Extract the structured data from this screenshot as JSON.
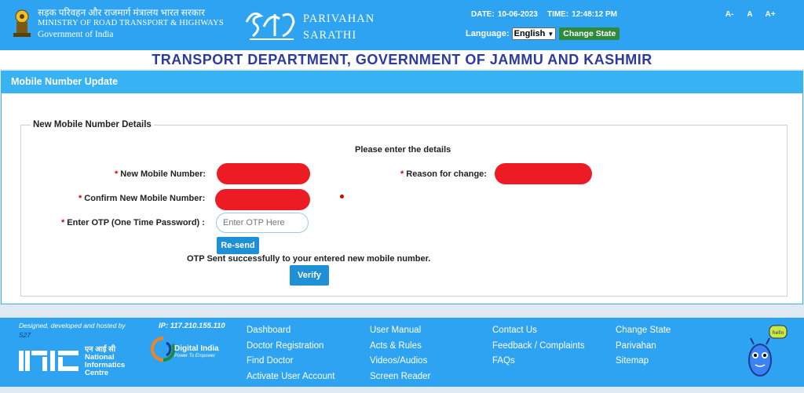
{
  "header": {
    "ministry_hindi": "सड़क परिवहन और राजमार्ग मंत्रालय भारत सरकार",
    "ministry_english": "MINISTRY OF ROAD TRANSPORT & HIGHWAYS",
    "government": "Government of India",
    "brand_line1": "PARIVAHAN",
    "brand_line2": "SARATHI",
    "date_label": "DATE:",
    "date_value": "10-06-2023",
    "time_label": "TIME:",
    "time_value": "12:48:12 PM",
    "language_label": "Language:",
    "language_value": "English",
    "change_state_label": "Change State",
    "font_small": "A-",
    "font_normal": "A",
    "font_large": "A+",
    "colors": {
      "bar": "#2ea3f2",
      "green_button": "#2f8a3b"
    }
  },
  "department_title": "TRANSPORT DEPARTMENT, GOVERNMENT OF JAMMU AND KASHMIR",
  "panel": {
    "title": "Mobile Number Update",
    "legend": "New Mobile Number Details",
    "instruction": "Please enter the details",
    "new_mobile_label": "New Mobile Number:",
    "confirm_mobile_label": "Confirm New Mobile Number:",
    "otp_label": "Enter OTP (One Time Password) :",
    "otp_placeholder": "Enter OTP Here",
    "reason_label": "Reason for change:",
    "required_mark": "*",
    "resend_label": "Re-send",
    "otp_message": "OTP Sent successfully to your entered new mobile number.",
    "verify_label": "Verify"
  },
  "footer": {
    "designed_by": "Designed, developed and hosted by",
    "code": "S27",
    "ip": "IP: 117.210.155.110",
    "nic_hindi": "एन आई सी",
    "nic_line1": "National",
    "nic_line2": "Informatics",
    "nic_line3": "Centre",
    "digital_india": "Digital India",
    "digital_india_sub": "Power To Empower",
    "col1": [
      "Dashboard",
      "Doctor Registration",
      "Find Doctor",
      "Activate User Account"
    ],
    "col2": [
      "User Manual",
      "Acts & Rules",
      "Videos/Audios",
      "Screen Reader"
    ],
    "col3": [
      "Contact Us",
      "Feedback / Complaints",
      "FAQs"
    ],
    "col4": [
      "Change State",
      "Parivahan",
      "Sitemap"
    ],
    "mascot_bubble": "hello"
  }
}
